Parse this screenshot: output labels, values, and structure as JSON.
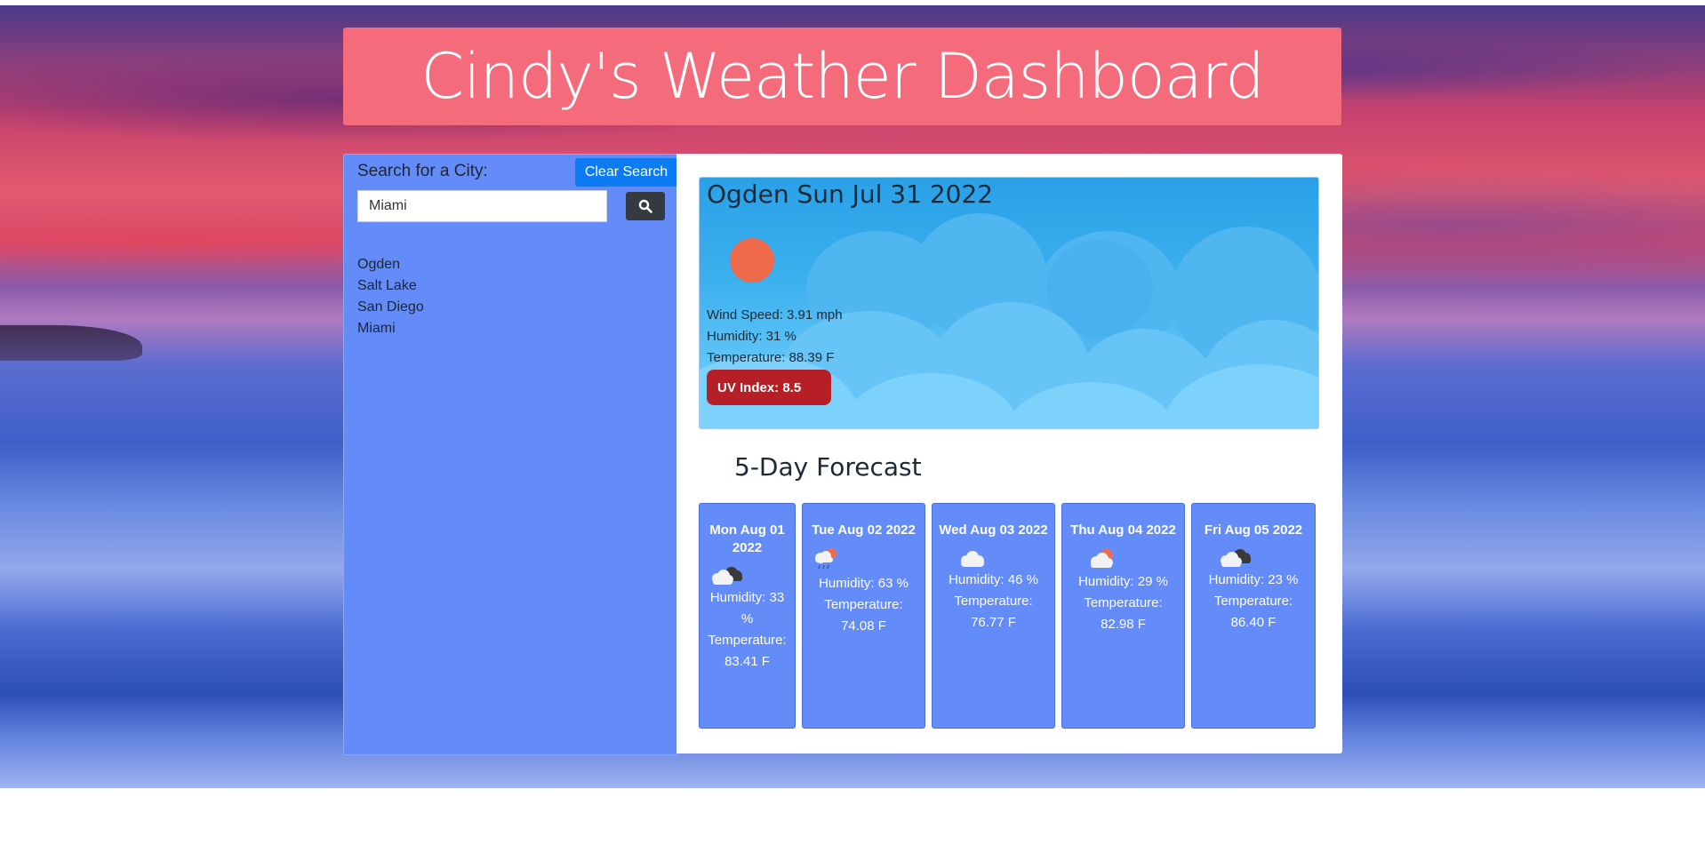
{
  "header": {
    "title": "Cindy's Weather Dashboard"
  },
  "sidebar": {
    "search_label": "Search for a City:",
    "clear_button": "Clear Search",
    "search_value": "Miami",
    "search_icon": "search-icon",
    "cities": [
      "Ogden",
      "Salt Lake",
      "San Diego",
      "Miami"
    ]
  },
  "current": {
    "title": "Ogden Sun Jul 31 2022",
    "icon": "sun-icon",
    "wind": "Wind Speed: 3.91 mph",
    "humidity": "Humidity: 31 %",
    "temperature": "Temperature: 88.39 F",
    "uv": "UV Index: 8.5",
    "uv_color": "#b51f25"
  },
  "forecast": {
    "title": "5-Day Forecast",
    "days": [
      {
        "date": "Mon Aug 01 2022",
        "icon": "broken-clouds-icon",
        "humidity": "Humidity: 33 %",
        "temperature": "Temperature: 83.41 F"
      },
      {
        "date": "Tue Aug 02 2022",
        "icon": "rain-sun-icon",
        "humidity": "Humidity: 63 %",
        "temperature": "Temperature: 74.08 F"
      },
      {
        "date": "Wed Aug 03 2022",
        "icon": "cloud-icon",
        "humidity": "Humidity: 46 %",
        "temperature": "Temperature: 76.77 F"
      },
      {
        "date": "Thu Aug 04 2022",
        "icon": "partly-cloudy-icon",
        "humidity": "Humidity: 29 %",
        "temperature": "Temperature: 82.98 F"
      },
      {
        "date": "Fri Aug 05 2022",
        "icon": "broken-clouds-icon",
        "humidity": "Humidity: 23 %",
        "temperature": "Temperature: 86.40 F"
      }
    ]
  },
  "colors": {
    "header": "#f46c7c",
    "sidebar": "#648cf9",
    "clear_button": "#0d7cf2",
    "search_button": "#343a40",
    "uv_badge": "#b51f25"
  }
}
